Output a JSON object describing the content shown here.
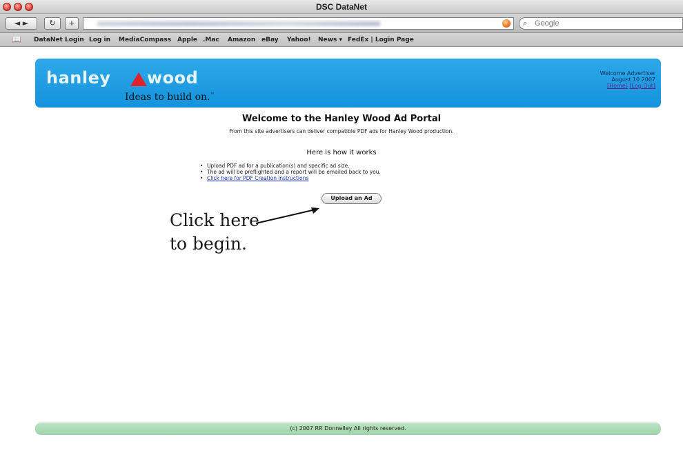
{
  "window": {
    "title": "DSC DataNet"
  },
  "toolbar": {
    "back_forward_label": "◄  ►",
    "reload_icon": "reload-icon",
    "add_label": "+",
    "search_placeholder": "Google"
  },
  "bookmarks": [
    "DataNet Login",
    "Log in",
    "MediaCompass",
    "Apple",
    ".Mac",
    "Amazon",
    "eBay",
    "Yahoo!",
    "News ▾",
    "FedEx | Login Page"
  ],
  "header": {
    "logo_word1": "hanley",
    "logo_word2": "wood",
    "tagline": "Ideas to build on.",
    "tagline_mark": "™",
    "welcome": "Welcome Advertiser",
    "date": "August 10 2007",
    "home_link": "[Home]",
    "logout_link": "[Log Out]",
    "brand_color": "#1e9be1",
    "accent_color": "#e0232a"
  },
  "main": {
    "title": "Welcome to the Hanley Wood Ad Portal",
    "subtitle": "From this site advertisers can deliver compatible PDF ads for Hanley Wood production.",
    "how_heading": "Here is how it works",
    "steps": [
      "Upload PDF ad for a publication(s) and specific ad size.",
      "The ad will be preflighted and a report will be emailed back to you."
    ],
    "instructions_link": "Click here for PDF Creation instructions",
    "upload_button": "Upload an Ad"
  },
  "callout": {
    "line1": "Click here",
    "line2": "to begin."
  },
  "footer": {
    "text": "(c) 2007 RR Donnelley All rights reserved."
  }
}
